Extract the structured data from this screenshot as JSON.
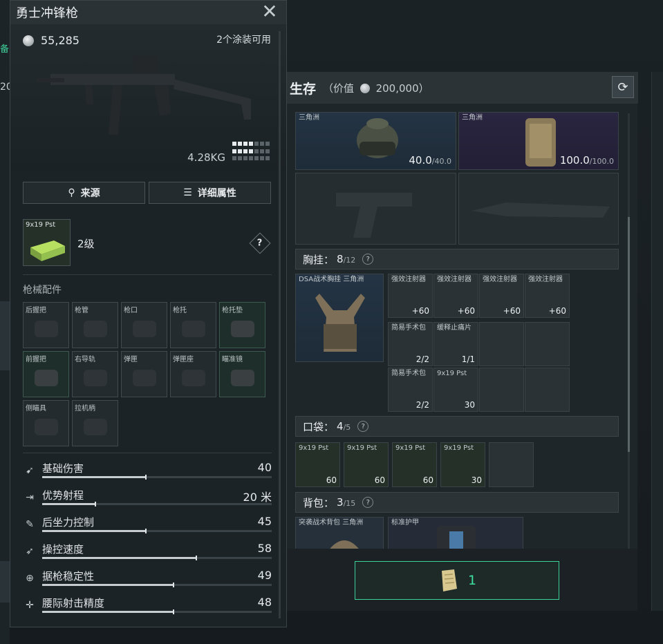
{
  "background": {
    "left_tag": "备",
    "left_num": "20"
  },
  "detail": {
    "title": "勇士冲锋枪",
    "price": "55,285",
    "skins": "2个涂装可用",
    "weight": "4.28KG",
    "source_label": "来源",
    "attributes_label": "详细属性",
    "ammo_label": "9x19 Pst",
    "level": "2级",
    "help": "?",
    "attachments_title": "枪械配件",
    "attachments": [
      {
        "name": "后握把",
        "equipped": false
      },
      {
        "name": "枪管",
        "equipped": false
      },
      {
        "name": "枪口",
        "equipped": false
      },
      {
        "name": "枪托",
        "equipped": false
      },
      {
        "name": "枪托垫",
        "equipped": true
      },
      {
        "name": "前握把",
        "equipped": true
      },
      {
        "name": "右导轨",
        "equipped": false
      },
      {
        "name": "弹匣",
        "equipped": false
      },
      {
        "name": "弹匣座",
        "equipped": false
      },
      {
        "name": "瞄准镜",
        "equipped": true
      },
      {
        "name": "侧瞄具",
        "equipped": false
      },
      {
        "name": "拉机柄",
        "equipped": false
      }
    ],
    "stats": [
      {
        "name": "基础伤害",
        "value": "40",
        "fill": 0.45,
        "icon": "damage-icon",
        "glyph": "➹"
      },
      {
        "name": "优势射程",
        "value": "20 米",
        "fill": 0.23,
        "icon": "range-icon",
        "glyph": "⇥"
      },
      {
        "name": "后坐力控制",
        "value": "45",
        "fill": 0.45,
        "icon": "recoil-icon",
        "glyph": "✎"
      },
      {
        "name": "操控速度",
        "value": "58",
        "fill": 0.67,
        "icon": "handling-icon",
        "glyph": "➶"
      },
      {
        "name": "据枪稳定性",
        "value": "49",
        "fill": 0.57,
        "icon": "stability-icon",
        "glyph": "⊕"
      },
      {
        "name": "腰际射击精度",
        "value": "48",
        "fill": 0.57,
        "icon": "hipfire-icon",
        "glyph": "✛"
      }
    ]
  },
  "survival": {
    "title": "生存",
    "value_prefix": "（价值",
    "value": "200,000）",
    "helmet_dur": "40.0",
    "helmet_max": "/40.0",
    "armor_dur": "100.0",
    "armor_max": "/100.0",
    "helmet_label": "三角洲",
    "armor_label": "三角洲",
    "chest": {
      "label": "胸挂：",
      "count": "8",
      "max": "/12"
    },
    "chest_item": "DSA战术胸挂 三角洲",
    "chest_slots": [
      {
        "label": "强效注射器",
        "count": "+60"
      },
      {
        "label": "强效注射器",
        "count": "+60"
      },
      {
        "label": "强效注射器",
        "count": "+60"
      },
      {
        "label": "强效注射器",
        "count": "+60"
      },
      {
        "label": "简易手术包",
        "count": "2/2"
      },
      {
        "label": "缓释止痛片",
        "count": "1/1"
      },
      {
        "label": "简易手术包",
        "count": "2/2"
      },
      {
        "label": "9x19 Pst",
        "count": "30"
      }
    ],
    "pocket": {
      "label": "口袋：",
      "count": "4",
      "max": "/5"
    },
    "pocket_slots": [
      {
        "label": "9x19 Pst",
        "count": "60"
      },
      {
        "label": "9x19 Pst",
        "count": "60"
      },
      {
        "label": "9x19 Pst",
        "count": "60"
      },
      {
        "label": "9x19 Pst",
        "count": "30"
      }
    ],
    "backpack": {
      "label": "背包：",
      "count": "3",
      "max": "/15"
    },
    "backpack_item": "突袭战术背包 三角洲",
    "backpack_slot2": "标准护甲",
    "claim_count": "1"
  },
  "colors": {
    "accent": "#3ee0a2",
    "panel": "#1c2327",
    "equipped_border": "#3c5a4e"
  }
}
